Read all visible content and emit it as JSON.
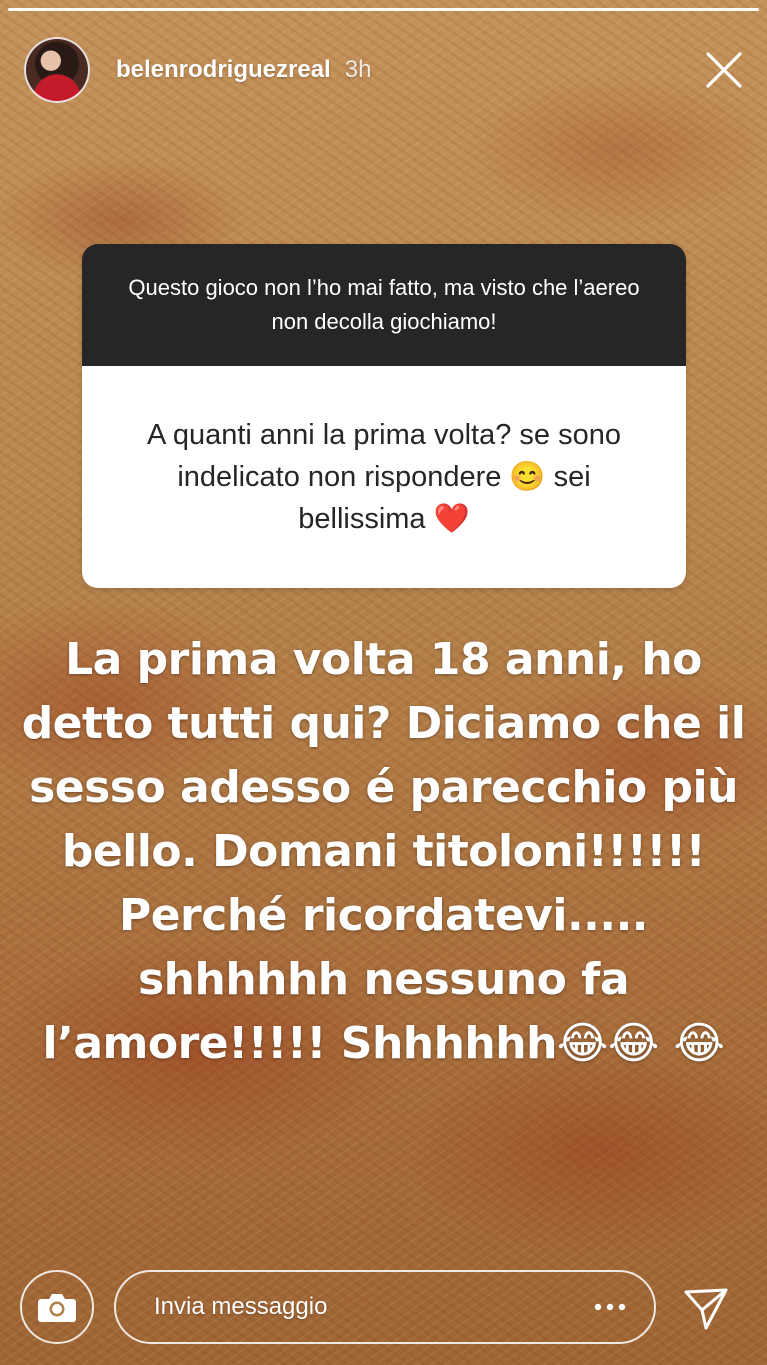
{
  "story": {
    "progress": 1.0,
    "username": "belenrodriguezreal",
    "timestamp": "3h"
  },
  "question_sticker": {
    "header": "Questo gioco non l’ho mai fatto, ma visto che l’aereo non decolla giochiamo!",
    "question": "A quanti anni la prima volta? se sono indelicato non rispondere 😊 sei bellissima ❤️"
  },
  "overlay_text": "La prima volta 18 anni, ho detto tutti qui? Diciamo che il sesso adesso é parecchio più bello. Domani titoloni!!!!!! Perché ricordatevi..... shhhhhh nessuno fa l’amore!!!!! Shhhhhh😂😂 😂",
  "reply_bar": {
    "placeholder": "Invia messaggio"
  },
  "icons": {
    "close": "close-icon",
    "camera": "camera-icon",
    "more": "more-icon",
    "send": "send-icon"
  }
}
